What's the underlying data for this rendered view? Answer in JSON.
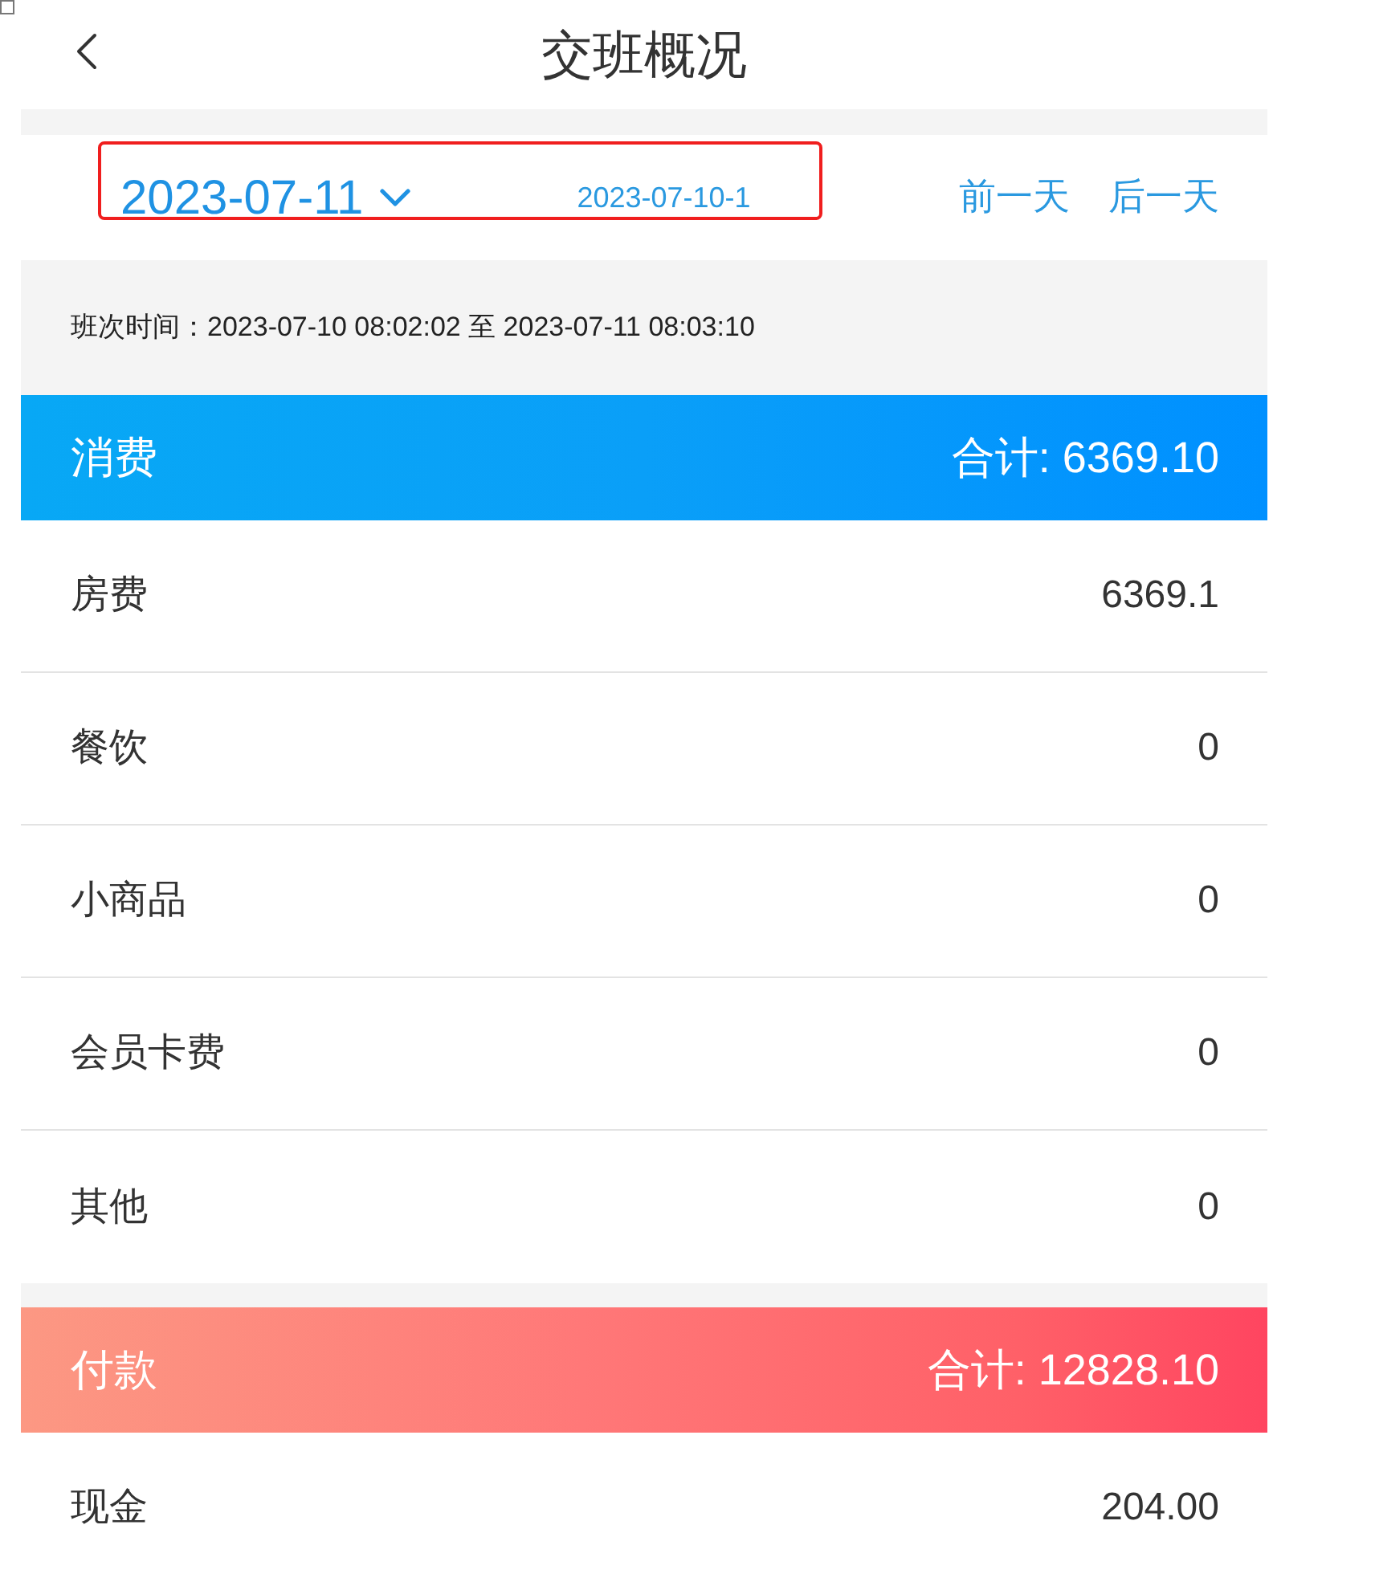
{
  "header": {
    "title": "交班概况"
  },
  "date_bar": {
    "date": "2023-07-11",
    "shift_id": "2023-07-10-1",
    "prev_label": "前一天",
    "next_label": "后一天"
  },
  "shift_time": "班次时间：2023-07-10 08:02:02 至 2023-07-11 08:03:10",
  "sections": [
    {
      "kind": "consumption",
      "title": "消费",
      "total": "合计: 6369.10",
      "rows": [
        {
          "label": "房费",
          "value": "6369.1"
        },
        {
          "label": "餐饮",
          "value": "0"
        },
        {
          "label": "小商品",
          "value": "0"
        },
        {
          "label": "会员卡费",
          "value": "0"
        },
        {
          "label": "其他",
          "value": "0"
        }
      ]
    },
    {
      "kind": "payment",
      "title": "付款",
      "total": "合计: 12828.10",
      "rows": [
        {
          "label": "现金",
          "value": "204.00"
        }
      ]
    }
  ]
}
